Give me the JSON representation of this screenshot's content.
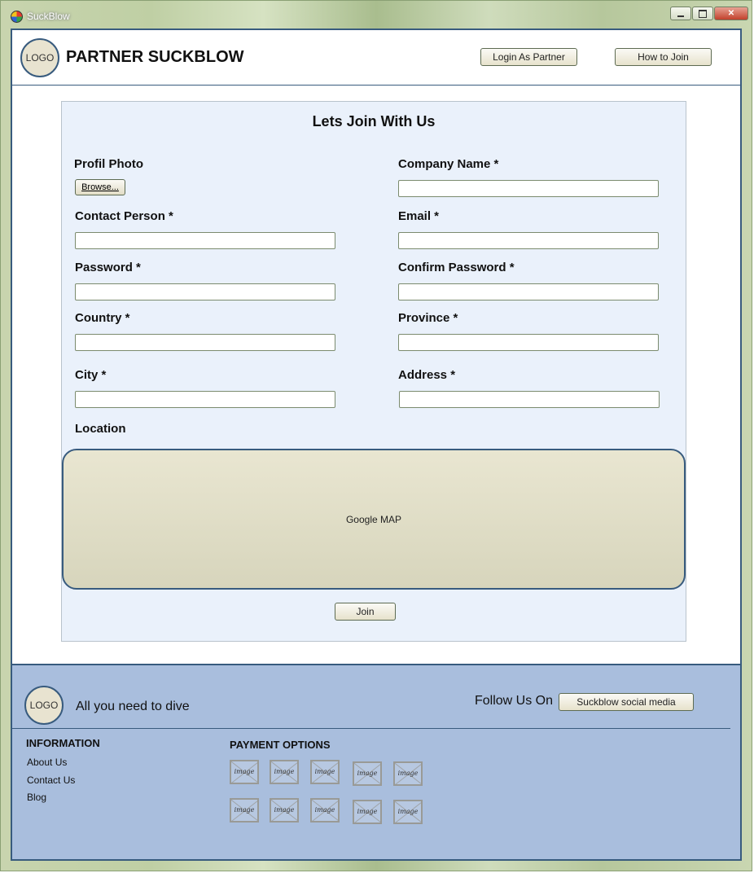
{
  "window": {
    "title": "SuckBlow",
    "icon": "app-icon",
    "controls": [
      "minimize-icon",
      "maximize-icon",
      "close-icon"
    ],
    "close_glyph": "✕"
  },
  "header": {
    "logo_text": "LOGO",
    "brand": "PARTNER SUCKBLOW",
    "login_button": "Login As Partner",
    "how_button": "How to Join"
  },
  "form": {
    "title": "Lets Join With Us",
    "profile_photo_label": "Profil Photo",
    "browse_label": "Browse...",
    "company_name_label": "Company Name *",
    "contact_person_label": "Contact Person *",
    "email_label": "Email *",
    "password_label": "Password *",
    "confirm_password_label": "Confirm Password *",
    "country_label": "Country *",
    "province_label": "Province *",
    "city_label": "City *",
    "address_label": "Address *",
    "location_label": "Location",
    "map_text": "Google MAP",
    "join_button": "Join",
    "values": {
      "company_name": "",
      "contact_person": "",
      "email": "",
      "password": "",
      "confirm_password": "",
      "country": "",
      "province": "",
      "city": "",
      "address": ""
    }
  },
  "footer": {
    "logo_text": "LOGO",
    "tagline": "All you need to dive",
    "follow_text": "Follow Us On",
    "social_button": "Suckblow social media",
    "info_title": "INFORMATION",
    "links": [
      "About Us",
      "Contact Us",
      "Blog"
    ],
    "payment_title": "PAYMENT OPTIONS",
    "payment_image_text": "image"
  },
  "colors": {
    "accent_border": "#385b7e",
    "panel_bg": "#eaf1fb",
    "footer_bg": "#a9bedd",
    "map_bg": "#e2dfc8"
  }
}
